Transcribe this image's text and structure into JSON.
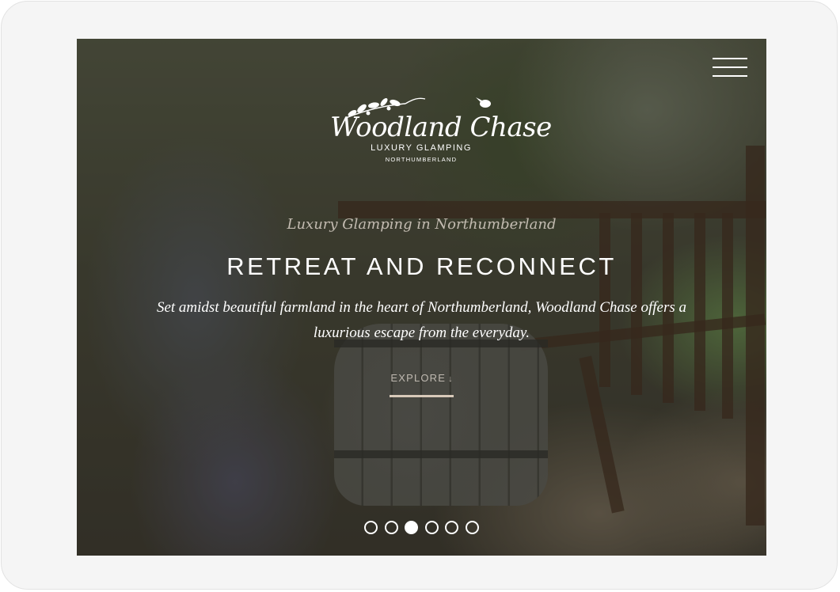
{
  "brand": {
    "name": "Woodland Chase",
    "subtitle": "LUXURY GLAMPING",
    "region": "NORTHUMBERLAND"
  },
  "header": {
    "menu_icon": "hamburger-menu-icon"
  },
  "hero": {
    "tagline": "Luxury Glamping in Northumberland",
    "title": "RETREAT AND RECONNECT",
    "description": "Set amidst beautiful farmland in the heart of Northumberland, Woodland Chase offers a luxurious escape from the everyday.",
    "cta_label": "EXPLORE",
    "cta_icon": "arrow-down-icon",
    "cta_arrow": "↓"
  },
  "carousel": {
    "slide_count": 6,
    "active_index": 2
  },
  "colors": {
    "text_primary": "#ffffff",
    "accent": "#d8c9b9"
  }
}
